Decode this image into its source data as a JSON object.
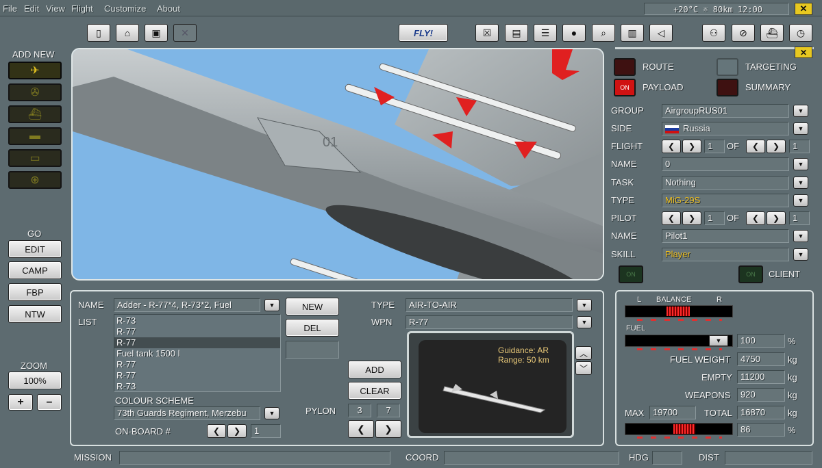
{
  "menu": {
    "items": [
      "File",
      "Edit",
      "View",
      "Flight",
      "Customize",
      "About"
    ],
    "status": "+20°C ☼ 80km 12:00"
  },
  "toolbar": {
    "fly_label": "FLY!"
  },
  "sidebar": {
    "add_new": "ADD NEW",
    "go": "GO",
    "edit": "EDIT",
    "camp": "CAMP",
    "fbp": "FBP",
    "ntw": "NTW",
    "zoom": "ZOOM",
    "zoom_value": "100%",
    "plus": "+",
    "minus": "–"
  },
  "right": {
    "route": "ROUTE",
    "targeting": "TARGETING",
    "payload": "PAYLOAD",
    "summary": "SUMMARY",
    "on": "ON",
    "group_label": "GROUP",
    "group": "AirgroupRUS01",
    "side_label": "SIDE",
    "side": "Russia",
    "flight_label": "FLIGHT",
    "flight_num": "1",
    "flight_of": "OF",
    "flight_total": "1",
    "name_label": "NAME",
    "name": "0",
    "task_label": "TASK",
    "task": "Nothing",
    "type_label": "TYPE",
    "type": "MiG-29S",
    "pilot_label": "PILOT",
    "pilot_num": "1",
    "pilot_of": "OF",
    "pilot_total": "1",
    "name2_label": "NAME",
    "name2": "Pilot1",
    "skill_label": "SKILL",
    "skill": "Player",
    "client": "CLIENT"
  },
  "payload": {
    "name_label": "NAME",
    "name": "Adder - R-77*4, R-73*2, Fuel",
    "list_label": "LIST",
    "list": [
      "R-73",
      "R-77",
      "R-77",
      "Fuel tank 1500 l",
      "R-77",
      "R-77",
      "R-73"
    ],
    "selected_index": 2,
    "new": "NEW",
    "del": "DEL",
    "add": "ADD",
    "clear": "CLEAR",
    "type_label": "TYPE",
    "type": "AIR-TO-AIR",
    "wpn_label": "WPN",
    "wpn": "R-77",
    "guidance": "Guidance: AR",
    "range": "Range: 50 km",
    "colour_label": "COLOUR SCHEME",
    "colour": "73th Guards Regiment, Merzebu",
    "onboard_label": "ON-BOARD #",
    "onboard": "1",
    "pylon_label": "PYLON",
    "pylon_a": "3",
    "pylon_b": "7"
  },
  "balance": {
    "title": "BALANCE",
    "l": "L",
    "r": "R",
    "fuel": "FUEL",
    "fuel_pct": "100",
    "pct": "%",
    "fuel_weight_label": "FUEL WEIGHT",
    "fuel_weight": "4750",
    "empty_label": "EMPTY",
    "empty": "11200",
    "weapons_label": "WEAPONS",
    "weapons": "920",
    "max_label": "MAX",
    "max": "19700",
    "total_label": "TOTAL",
    "total": "16870",
    "kg": "kg",
    "load_pct": "86"
  },
  "bottom": {
    "mission": "MISSION",
    "coord": "COORD",
    "hdg": "HDG",
    "dist": "DIST"
  }
}
